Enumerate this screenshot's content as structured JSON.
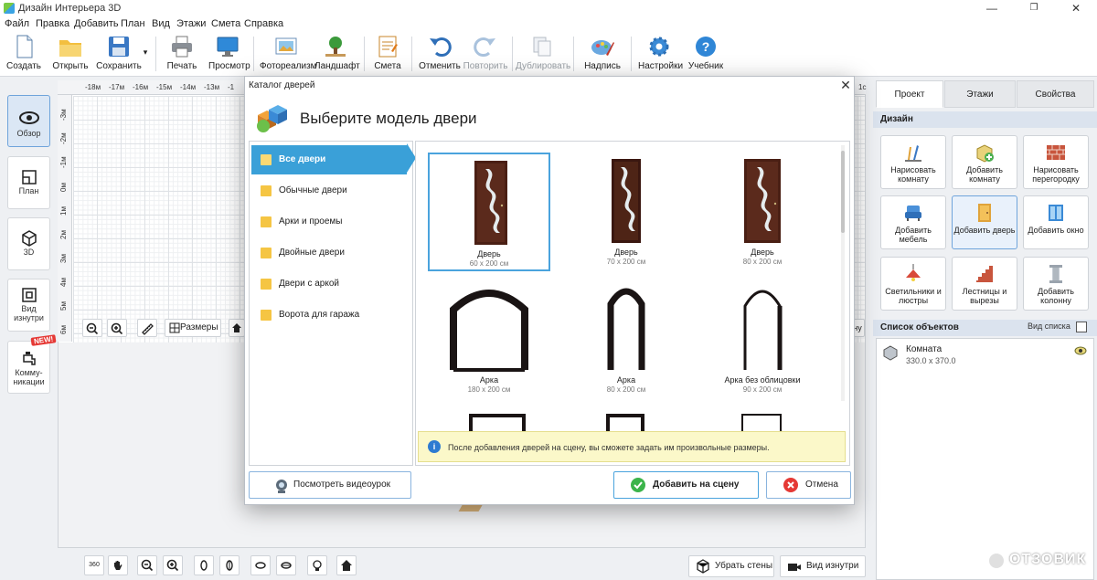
{
  "app": {
    "title": "Дизайн Интерьера 3D"
  },
  "window_controls": {
    "minimize": "—",
    "maximize": "❐",
    "close": "✕"
  },
  "menu": [
    "Файл",
    "Правка",
    "Добавить",
    "План",
    "Вид",
    "Этажи",
    "Смета",
    "Справка"
  ],
  "toolbar": {
    "create": "Создать",
    "open": "Открыть",
    "save": "Сохранить",
    "save_arrow": "▾",
    "print": "Печать",
    "preview": "Просмотр",
    "photo": "Фотореализм",
    "landscape": "Ландшафт",
    "estimate": "Смета",
    "undo": "Отменить",
    "redo": "Повторить",
    "duplicate": "Дублировать",
    "label": "Надпись",
    "settings": "Настройки",
    "tutorial": "Учебник"
  },
  "left_nav": {
    "overview": "Обзор",
    "plan": "План",
    "3d": "3D",
    "inside_view": "Вид изнутри",
    "comms": "Комму-никации",
    "new_badge": "NEW!"
  },
  "ruler": {
    "top": [
      "-18м",
      "-17м",
      "-16м",
      "-15м",
      "-14м",
      "-13м",
      "-1",
      "1с"
    ],
    "left": [
      "-3м",
      "-2м",
      "-1м",
      "0м",
      "1м",
      "2м",
      "3м",
      "4м",
      "5м",
      "6м",
      "7м"
    ]
  },
  "plan_controls": {
    "sizes": "Размеры",
    "right_label": "ну"
  },
  "bottom_bar": {
    "remove_walls": "Убрать стены",
    "inside_view": "Вид изнутри",
    "btn_360": "360"
  },
  "right_panel": {
    "tabs": [
      "Проект",
      "Этажи",
      "Свойства"
    ],
    "design_header": "Дизайн",
    "buttons": [
      "Нарисовать комнату",
      "Добавить комнату",
      "Нарисовать перегородку",
      "Добавить мебель",
      "Добавить дверь",
      "Добавить окно",
      "Светильники и люстры",
      "Лестницы и вырезы",
      "Добавить колонну"
    ],
    "objects_header": "Список объектов",
    "list_view": "Вид списка",
    "objects": [
      {
        "name": "Комната",
        "size": "330.0 x 370.0"
      }
    ]
  },
  "dialog": {
    "title": "Каталог дверей",
    "heading": "Выберите модель двери",
    "categories": [
      "Все двери",
      "Обычные двери",
      "Арки и проемы",
      "Двойные двери",
      "Двери с аркой",
      "Ворота для гаража"
    ],
    "models": [
      {
        "name": "Дверь",
        "size": "60 x 200 см"
      },
      {
        "name": "Дверь",
        "size": "70 x 200 см"
      },
      {
        "name": "Дверь",
        "size": "80 x 200 см"
      },
      {
        "name": "Арка",
        "size": "180 x 200 см"
      },
      {
        "name": "Арка",
        "size": "80 x 200 см"
      },
      {
        "name": "Арка без облицовки",
        "size": "90 x 200 см"
      }
    ],
    "info": "После добавления дверей на сцену, вы сможете задать им произвольные размеры.",
    "video_button": "Посмотреть видеоурок",
    "add_button": "Добавить на сцену",
    "cancel_button": "Отмена"
  },
  "watermark": "ОТЗОВИК"
}
